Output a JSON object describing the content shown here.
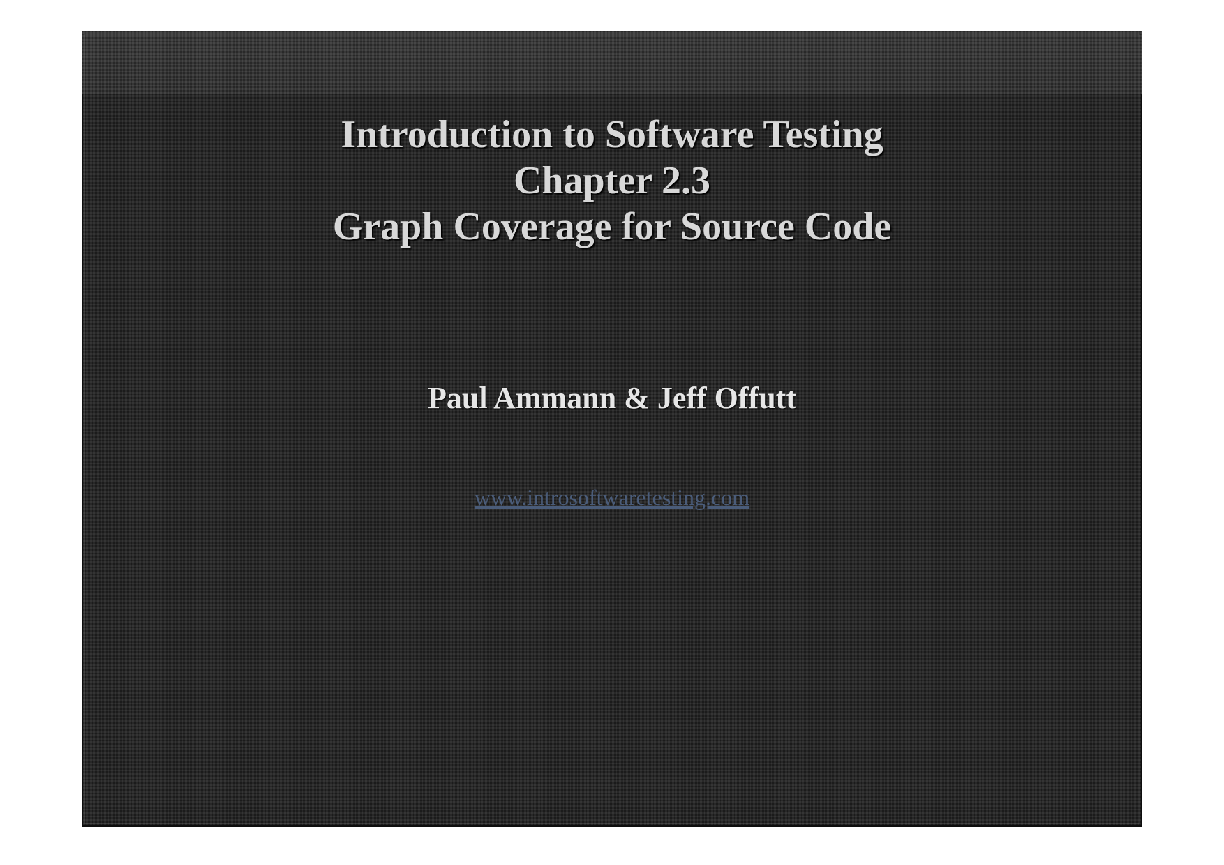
{
  "slide": {
    "title_line1": "Introduction to Software Testing",
    "title_line2": "Chapter 2.3",
    "title_line3": "Graph Coverage for Source Code",
    "authors": "Paul Ammann & Jeff Offutt",
    "link_text": "www.introsoftwaretesting.com"
  }
}
